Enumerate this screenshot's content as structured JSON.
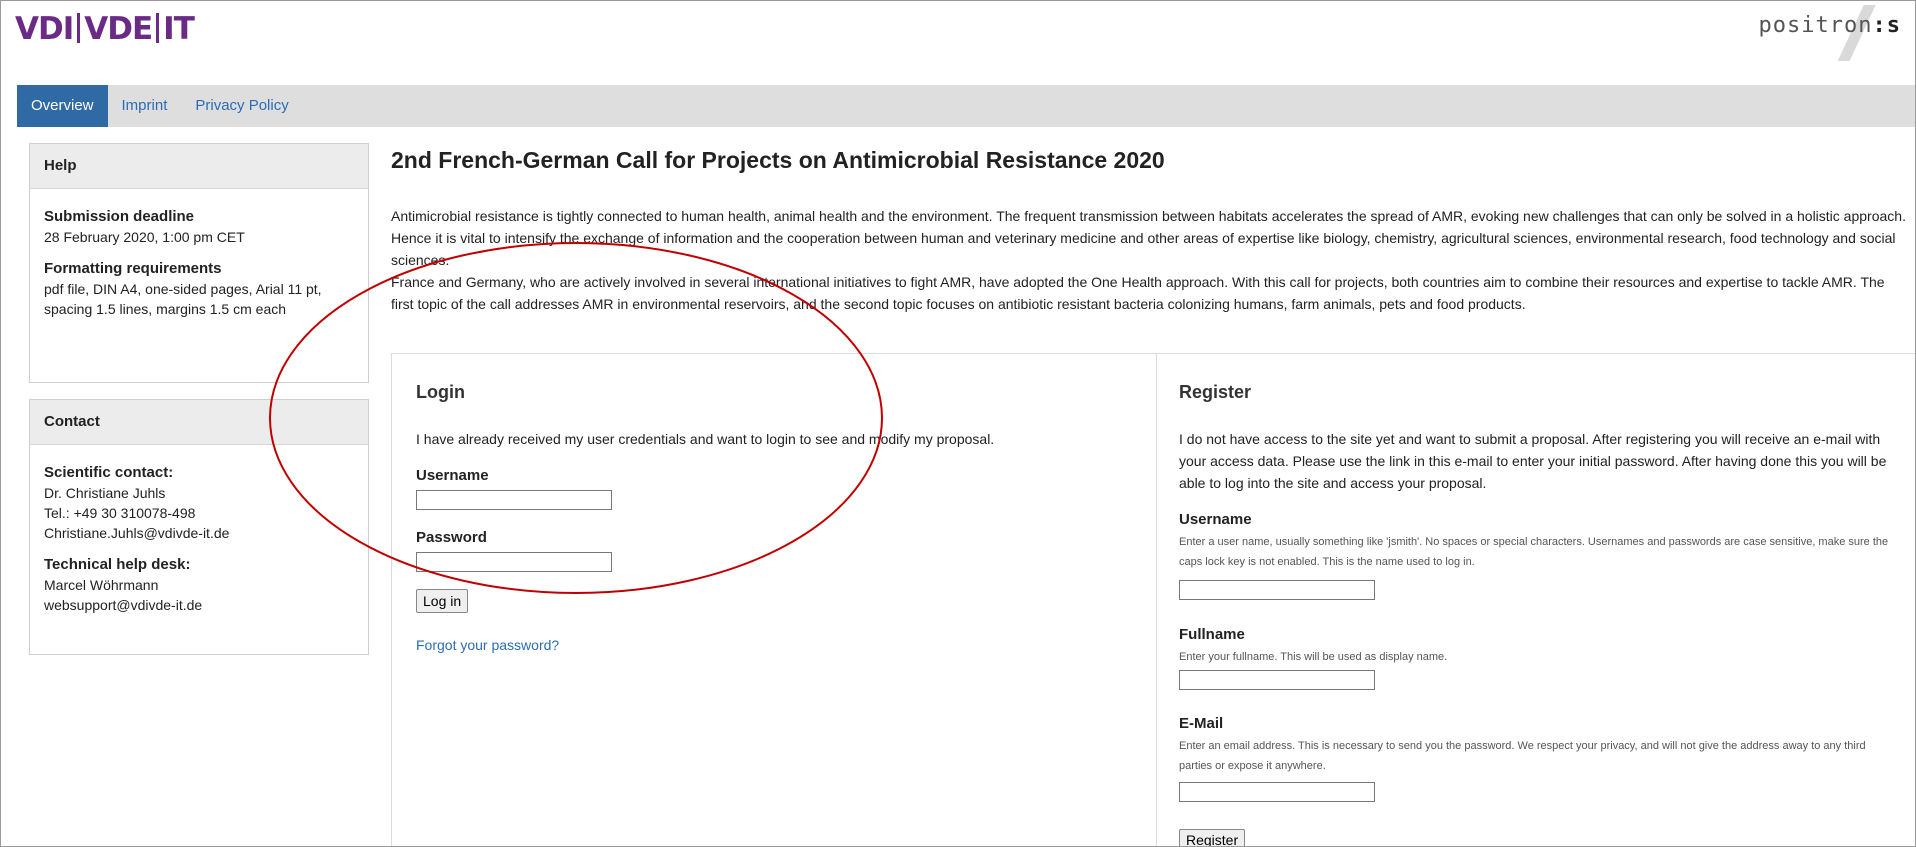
{
  "header": {
    "logo_parts": [
      "VDI",
      "VDE",
      "IT"
    ],
    "brand_right_prefix": "positron",
    "brand_right_suffix": ":s"
  },
  "nav": {
    "tabs": [
      {
        "label": "Overview"
      },
      {
        "label": "Imprint"
      },
      {
        "label": "Privacy Policy"
      }
    ]
  },
  "sidebar": {
    "help": {
      "title": "Help",
      "deadline_label": "Submission deadline",
      "deadline_value": "28 February 2020, 1:00 pm CET",
      "formatting_label": "Formatting requirements",
      "formatting_line1": "pdf file, DIN A4, one-sided pages, Arial 11 pt,",
      "formatting_line2": "spacing 1.5 lines, margins 1.5 cm each"
    },
    "contact": {
      "title": "Contact",
      "sci_label": "Scientific contact:",
      "sci_name": "Dr. Christiane Juhls",
      "sci_tel": "Tel.: +49 30 310078-498",
      "sci_email": "Christiane.Juhls@vdivde-it.de",
      "tech_label": "Technical help desk:",
      "tech_name": "Marcel Wöhrmann",
      "tech_email": "websupport@vdivde-it.de"
    }
  },
  "main": {
    "title": "2nd French-German Call for Projects on Antimicrobial Resistance 2020",
    "intro_p1": "Antimicrobial resistance is tightly connected to human health, animal health and the environment. The frequent transmission between habitats accelerates the spread of AMR, evoking new challenges that can only be solved in a holistic approach. Hence it is vital to intensify the exchange of information and the cooperation between human and veterinary medicine and other areas of expertise like biology, chemistry, agricultural sciences, environmental research, food technology and social sciences.",
    "intro_p2": "France and Germany, who are actively involved in several international initiatives to fight AMR, have adopted the One Health approach. With this call for projects, both countries aim to combine their resources and expertise to tackle AMR. The first topic of the call addresses AMR in environmental reservoirs, and the second topic focuses on antibiotic resistant bacteria colonizing humans, farm animals, pets and food products."
  },
  "login": {
    "heading": "Login",
    "description": "I have already received my user credentials and want to login to see and modify my proposal.",
    "username_label": "Username",
    "password_label": "Password",
    "submit_label": "Log in",
    "forgot_link": "Forgot your password?"
  },
  "register": {
    "heading": "Register",
    "description": "I do not have access to the site yet and want to submit a proposal. After registering you will receive an e-mail with your access data. Please use the link in this e-mail to enter your initial password. After having done this you will be able to log into the site and access your proposal.",
    "username_label": "Username",
    "username_help": "Enter a user name, usually something like 'jsmith'. No spaces or special characters. Usernames and passwords are case sensitive, make sure the caps lock key is not enabled. This is the name used to log in.",
    "fullname_label": "Fullname",
    "fullname_help": "Enter your fullname. This will be used as display name.",
    "email_label": "E-Mail",
    "email_help": "Enter an email address. This is necessary to send you the password. We respect your privacy, and will not give the address away to any third parties or expose it anywhere.",
    "submit_label": "Register"
  },
  "annotation": {
    "color": "#c00000"
  }
}
